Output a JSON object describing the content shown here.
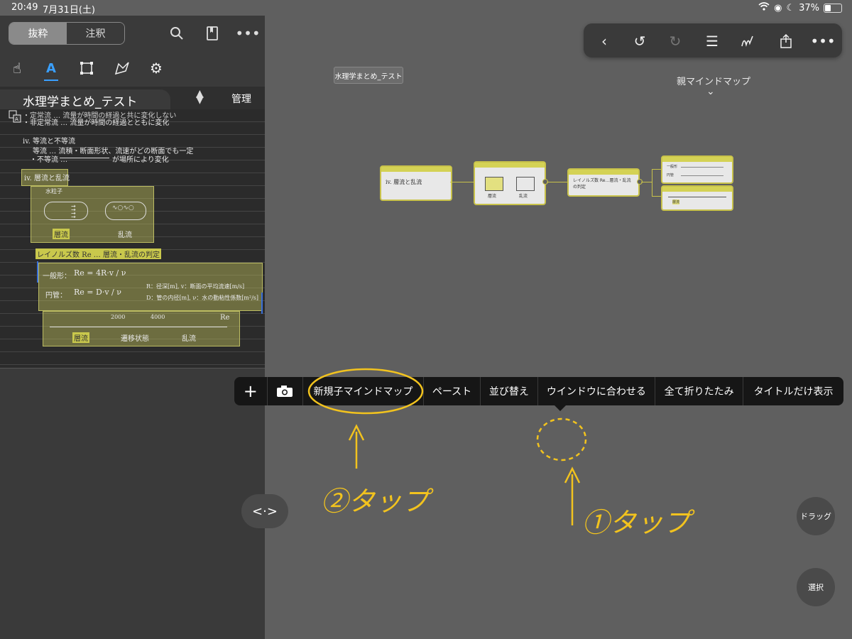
{
  "status_bar": {
    "time": "20:49",
    "date": "7月31日(土)",
    "battery": "37%"
  },
  "left_panel": {
    "segments": [
      {
        "label": "抜粋",
        "active": true
      },
      {
        "label": "注釈",
        "active": false
      }
    ],
    "doc_title": "水理学まとめ_テスト",
    "manage_label": "管理",
    "notes": {
      "line1": "・定常流 … 流量が時間の経過と共に変化しない",
      "line2": "・非定常流 … 流量が時間の経過とともに変化",
      "line3": "iv. 等流と不等流",
      "line4": "等流 … 流積・断面形状、流速がどの断面でも一定",
      "line5": "・不等流 …",
      "line5b": "が場所により変化",
      "heading": "iv. 層流と乱流",
      "pipe_label": "水粒子",
      "laminar": "層流",
      "turbulent": "乱流",
      "reynolds": "レイノルズ数 Re … 層流・乱流の判定",
      "general": "一般形：",
      "formula1": "Re = 4R·v / ν",
      "circular": "円管：",
      "formula2": "Re = D·v / ν",
      "def1": "R：径深[m], v：断面の平均流速[m/s]",
      "def2": "D：管の内径[m], ν：水の動粘性係数[m²/s]",
      "n2000": "2000",
      "n4000": "4000",
      "re": "Re",
      "range1": "層流",
      "range2": "遷移状態",
      "range3": "乱流"
    }
  },
  "canvas": {
    "title_tag": "水理学まとめ_テスト",
    "parent_map": "親マインドマップ",
    "nodes": {
      "n1": "iv. 層流と乱流",
      "n2a": "層流",
      "n2b": "乱流",
      "n3": "レイノルズ数 Re…層流・乱流の判定",
      "n4a": "一般形",
      "n4b": "円管",
      "n5": "層流"
    }
  },
  "context_menu": {
    "items": [
      "新規子マインドマップ",
      "ペースト",
      "並び替え",
      "ウインドウに合わせる",
      "全て折りたたみ",
      "タイトルだけ表示"
    ]
  },
  "buttons": {
    "drag": "ドラッグ",
    "select": "選択",
    "handle": "<·>"
  },
  "annotations": {
    "tap2": "②タップ",
    "tap1": "①タップ",
    "color": "#f2c31e"
  }
}
